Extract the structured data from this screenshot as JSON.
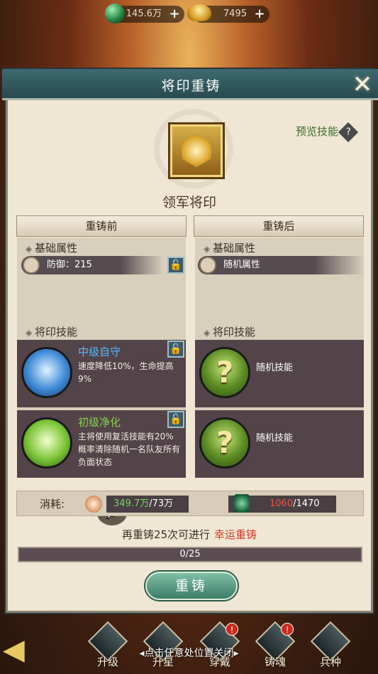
{
  "top": {
    "jade_amount": "145.6万",
    "gold_amount": "7495"
  },
  "dialog": {
    "title": "将印重铸",
    "preview_label": "预览技能",
    "seal_name": "领军将印",
    "before_label": "重铸前",
    "after_label": "重铸后",
    "base_attr_label": "基础属性",
    "skill_label": "将印技能",
    "before": {
      "attr": "防御：215",
      "skills": [
        {
          "name": "中级自守",
          "desc": "速度降低10%，生命提高9%",
          "color": "#5ab8ff"
        },
        {
          "name": "初级净化",
          "desc": "主将使用复活技能有20%概率清除随机一名队友所有负面状态",
          "color": "#8ad24a"
        }
      ]
    },
    "after": {
      "attr": "随机属性",
      "skills": [
        "随机技能",
        "随机技能"
      ]
    },
    "cost": {
      "label": "消耗:",
      "coin_have": "349.7万",
      "coin_need": "/73万",
      "jade_have": "1060",
      "jade_need": "/1470"
    },
    "recast_info": "再重铸25次可进行",
    "lucky_label": "幸运重铸",
    "progress_text": "0/25",
    "progress_value": 0,
    "button_label": "重铸"
  },
  "bottom": {
    "hint": "点击任意处位置关闭",
    "nav": [
      "升级",
      "升星",
      "穿戴",
      "铸魂",
      "兵种"
    ]
  }
}
